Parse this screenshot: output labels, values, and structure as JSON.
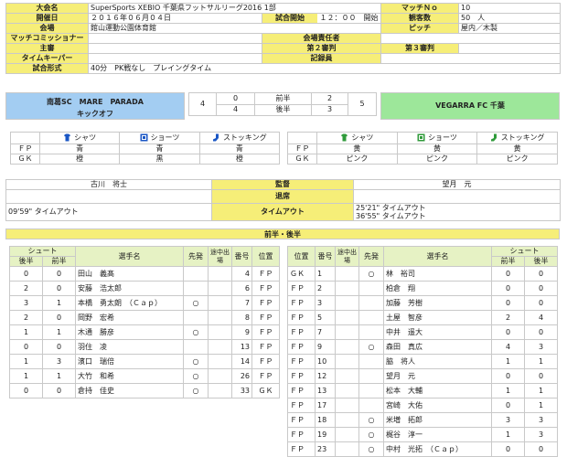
{
  "info": {
    "tournament_label": "大会名",
    "tournament": "SuperSports XEBIO 千葉県フットサルリーグ2016 1部",
    "match_no_label": "マッチＮｏ",
    "match_no": "10",
    "date_label": "開催日",
    "date": "２０１６年０６月０４日",
    "kickoff_label": "試合開始",
    "kickoff": "１２：００　開始",
    "attendance_label": "観客数",
    "attendance": "50　人",
    "venue_label": "会場",
    "venue": "館山運動公園体育館",
    "pitch_label": "ピッチ",
    "pitch": "屋内／木製",
    "commissioner_label": "マッチコミッショナー",
    "manager_label": "会場責任者",
    "referee_label": "主審",
    "second_ref_label": "第２審判",
    "third_ref_label": "第３審判",
    "timekeeper_label": "タイムキーパー",
    "recorder_label": "記録員",
    "format_label": "試合形式",
    "format": "40分　PK戦なし　プレイングタイム"
  },
  "score": {
    "home_team": "南葛SC　MARE　PARADA",
    "kickoff_note": "キックオフ",
    "home_total": "4",
    "home_first": "0",
    "home_second": "4",
    "first_half": "前半",
    "second_half": "後半",
    "away_first": "2",
    "away_second": "3",
    "away_total": "5",
    "away_team": "VEGARRA FC 千葉"
  },
  "kit_headers": {
    "shirt": "シャツ",
    "shorts": "ショーツ",
    "socks": "ストッキング"
  },
  "home_kit": [
    {
      "pos": "ＦＰ",
      "shirt": "青",
      "shorts": "青",
      "socks": "青"
    },
    {
      "pos": "ＧＫ",
      "shirt": "橙",
      "shorts": "黒",
      "socks": "橙"
    }
  ],
  "away_kit": [
    {
      "pos": "ＦＰ",
      "shirt": "黄",
      "shorts": "黄",
      "socks": "黄"
    },
    {
      "pos": "ＧＫ",
      "shirt": "ピンク",
      "shorts": "ピンク",
      "socks": "ピンク"
    }
  ],
  "staff": {
    "home_coach": "古川　将士",
    "coach_label": "監督",
    "away_coach": "望月　元",
    "sendoff_label": "退席",
    "home_timeout": "09'59\" タイムアウト",
    "timeout_label": "タイムアウト",
    "away_timeout_1": "25'21\" タイムアウト",
    "away_timeout_2": "36'55\" タイムアウト"
  },
  "section_title": "前半・後半",
  "cols": {
    "shoot": "シュート",
    "second": "後半",
    "first": "前半",
    "player": "選手名",
    "starter": "先発",
    "sub": "途中出場",
    "number": "番号",
    "position": "位置"
  },
  "home_players": [
    {
      "s2": "0",
      "s1": "0",
      "name": "田山　義髙",
      "st": "",
      "sub": "",
      "no": "4",
      "pos": "ＦＰ"
    },
    {
      "s2": "2",
      "s1": "0",
      "name": "安藤　浩太郎",
      "st": "",
      "sub": "",
      "no": "6",
      "pos": "ＦＰ"
    },
    {
      "s2": "3",
      "s1": "1",
      "name": "本橋　勇太朗　（Ｃａｐ）",
      "st": "○",
      "sub": "",
      "no": "7",
      "pos": "ＦＰ"
    },
    {
      "s2": "2",
      "s1": "0",
      "name": "岡野　宏希",
      "st": "",
      "sub": "",
      "no": "8",
      "pos": "ＦＰ"
    },
    {
      "s2": "1",
      "s1": "1",
      "name": "木通　勝彦",
      "st": "○",
      "sub": "",
      "no": "9",
      "pos": "ＦＰ"
    },
    {
      "s2": "0",
      "s1": "0",
      "name": "羽住　凌",
      "st": "",
      "sub": "",
      "no": "13",
      "pos": "ＦＰ"
    },
    {
      "s2": "1",
      "s1": "3",
      "name": "濱口　瑞倍",
      "st": "○",
      "sub": "",
      "no": "14",
      "pos": "ＦＰ"
    },
    {
      "s2": "1",
      "s1": "1",
      "name": "大竹　和希",
      "st": "○",
      "sub": "",
      "no": "26",
      "pos": "ＦＰ"
    },
    {
      "s2": "0",
      "s1": "0",
      "name": "倉持　佳史",
      "st": "○",
      "sub": "",
      "no": "33",
      "pos": "ＧＫ"
    }
  ],
  "away_players": [
    {
      "pos": "ＧＫ",
      "no": "1",
      "sub": "",
      "st": "○",
      "name": "林　裕司",
      "s1": "0",
      "s2": "0"
    },
    {
      "pos": "ＦＰ",
      "no": "2",
      "sub": "",
      "st": "",
      "name": "柏倉　翔",
      "s1": "0",
      "s2": "0"
    },
    {
      "pos": "ＦＰ",
      "no": "3",
      "sub": "",
      "st": "",
      "name": "加藤　芳樹",
      "s1": "0",
      "s2": "0"
    },
    {
      "pos": "ＦＰ",
      "no": "5",
      "sub": "",
      "st": "",
      "name": "土屋　智彦",
      "s1": "2",
      "s2": "4"
    },
    {
      "pos": "ＦＰ",
      "no": "7",
      "sub": "",
      "st": "",
      "name": "中井　遥大",
      "s1": "0",
      "s2": "0"
    },
    {
      "pos": "ＦＰ",
      "no": "9",
      "sub": "",
      "st": "○",
      "name": "森田　真広",
      "s1": "4",
      "s2": "3"
    },
    {
      "pos": "ＦＰ",
      "no": "10",
      "sub": "",
      "st": "",
      "name": "脇　将人",
      "s1": "1",
      "s2": "1"
    },
    {
      "pos": "ＦＰ",
      "no": "12",
      "sub": "",
      "st": "",
      "name": "望月　元",
      "s1": "0",
      "s2": "0"
    },
    {
      "pos": "ＦＰ",
      "no": "13",
      "sub": "",
      "st": "",
      "name": "松本　大輔",
      "s1": "1",
      "s2": "1"
    },
    {
      "pos": "ＦＰ",
      "no": "17",
      "sub": "",
      "st": "",
      "name": "宮崎　大佑",
      "s1": "0",
      "s2": "1"
    },
    {
      "pos": "ＦＰ",
      "no": "18",
      "sub": "",
      "st": "○",
      "name": "米増　拓郎",
      "s1": "3",
      "s2": "3"
    },
    {
      "pos": "ＦＰ",
      "no": "19",
      "sub": "",
      "st": "○",
      "name": "梶谷　淳一",
      "s1": "1",
      "s2": "3"
    },
    {
      "pos": "ＦＰ",
      "no": "23",
      "sub": "",
      "st": "○",
      "name": "中村　光拓　（Ｃａｐ）",
      "s1": "0",
      "s2": "0"
    }
  ],
  "colors": {
    "yellow": "#f6ee78",
    "home_blue": "#a3cdf2",
    "away_green": "#9de79a",
    "icon": "#1a56c4"
  }
}
